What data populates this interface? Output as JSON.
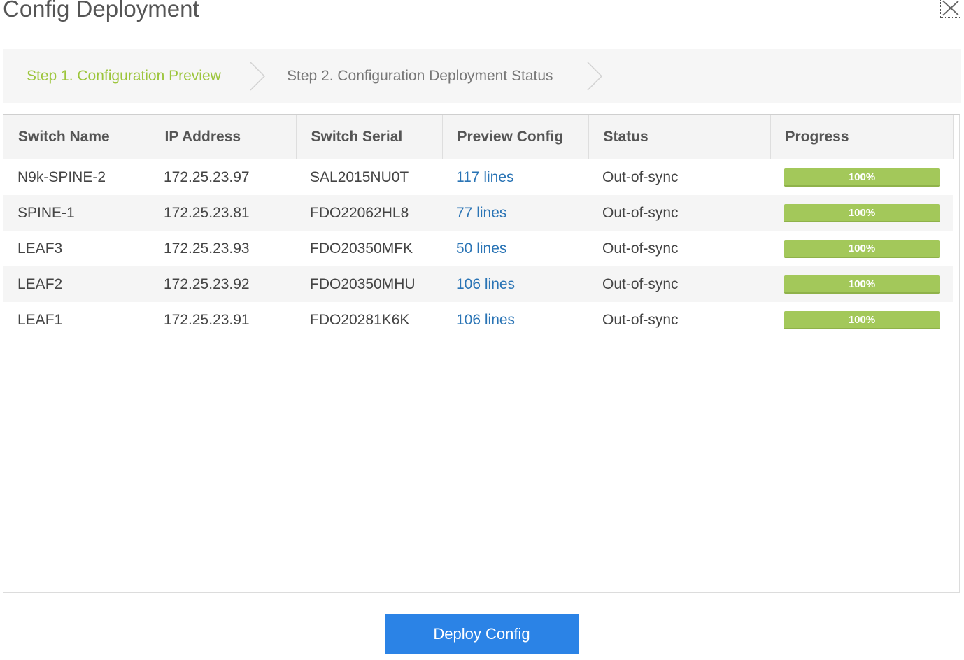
{
  "dialog": {
    "title": "Config Deployment",
    "close_icon": "close-icon"
  },
  "steps": [
    {
      "label": "Step 1. Configuration Preview",
      "active": true
    },
    {
      "label": "Step 2. Configuration Deployment Status",
      "active": false
    }
  ],
  "table": {
    "columns": [
      "Switch Name",
      "IP Address",
      "Switch Serial",
      "Preview Config",
      "Status",
      "Progress"
    ],
    "rows": [
      {
        "switch_name": "N9k-SPINE-2",
        "ip": "172.25.23.97",
        "serial": "SAL2015NU0T",
        "preview": "117 lines",
        "status": "Out-of-sync",
        "progress_label": "100%",
        "progress": 100
      },
      {
        "switch_name": "SPINE-1",
        "ip": "172.25.23.81",
        "serial": "FDO22062HL8",
        "preview": "77 lines",
        "status": "Out-of-sync",
        "progress_label": "100%",
        "progress": 100
      },
      {
        "switch_name": "LEAF3",
        "ip": "172.25.23.93",
        "serial": "FDO20350MFK",
        "preview": "50 lines",
        "status": "Out-of-sync",
        "progress_label": "100%",
        "progress": 100
      },
      {
        "switch_name": "LEAF2",
        "ip": "172.25.23.92",
        "serial": "FDO20350MHU",
        "preview": "106 lines",
        "status": "Out-of-sync",
        "progress_label": "100%",
        "progress": 100
      },
      {
        "switch_name": "LEAF1",
        "ip": "172.25.23.91",
        "serial": "FDO20281K6K",
        "preview": "106 lines",
        "status": "Out-of-sync",
        "progress_label": "100%",
        "progress": 100
      }
    ]
  },
  "footer": {
    "deploy_label": "Deploy Config"
  },
  "colors": {
    "active_step": "#9cc53b",
    "inactive_step": "#777777",
    "link": "#2a74b5",
    "progress_fill": "#a3c85a",
    "primary_button": "#2b83e6"
  }
}
